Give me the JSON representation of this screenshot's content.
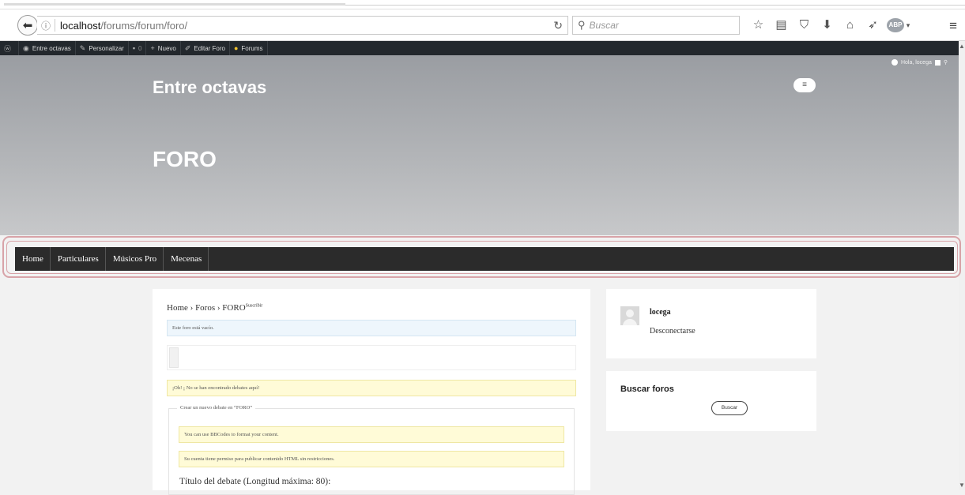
{
  "browser": {
    "url_host": "localhost",
    "url_path": "/forums/forum/foro/",
    "search_placeholder": "Buscar",
    "abp_label": "ABP"
  },
  "adminbar": {
    "site": "Entre octavas",
    "customize": "Personalizar",
    "comments_count": "0",
    "new": "Nuevo",
    "edit": "Editar Foro",
    "forums": "Forums"
  },
  "header": {
    "site_title": "Entre octavas",
    "menu_glyph": "≡",
    "greeting": "Hola, locega",
    "page_heading": "FORO"
  },
  "nav": {
    "items": [
      "Home",
      "Particulares",
      "Músicos Pro",
      "Mecenas"
    ]
  },
  "content": {
    "breadcrumb_home": "Home",
    "breadcrumb_sep": "›",
    "breadcrumb_foros": "Foros",
    "breadcrumb_current": "FORO",
    "subscribe": "Suscribir",
    "empty_forum": "Este foro está vacío.",
    "no_topics": "¡Oh! ¡ No se han encontrado debates aquí!",
    "new_topic_legend": "Crear un nuevo debate en “FORO”",
    "bbcodes_note": "You can use BBCodes to format your content.",
    "html_note": "Su cuenta tiene permiso para publicar contenido HTML sin restricciones.",
    "title_label": "Título del debate (Longitud máxima: 80):"
  },
  "sidebar": {
    "username": "locega",
    "logout": "Desconectarse",
    "search_title": "Buscar foros",
    "search_button": "Buscar"
  },
  "colors": {
    "nav_bg": "#2b2b2b",
    "adminbar_bg": "#23282d",
    "highlight_outline": "#d8a3a8",
    "notice_yellow": "#fffbd7",
    "notice_blue": "#eef6fc"
  }
}
